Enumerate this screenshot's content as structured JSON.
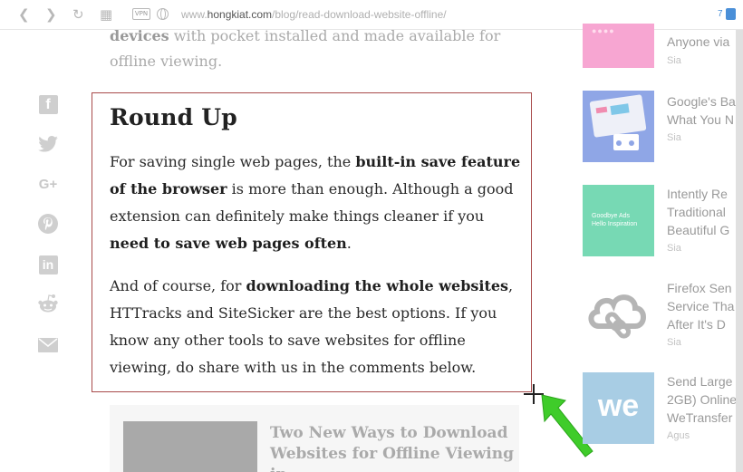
{
  "browser": {
    "url_prefix": "www.",
    "url_domain": "hongkiat.com",
    "url_path": "/blog/read-download-website-offline/",
    "vpn_label": "VPN",
    "ext_badge": "7",
    "icons": [
      "back-icon",
      "forward-icon",
      "reload-icon",
      "grid-icon",
      "globe-icon"
    ]
  },
  "article": {
    "top_bold": "devices",
    "top_rest": " with pocket installed and made available for offline viewing.",
    "heading": "Round Up",
    "p1": [
      {
        "t": "For saving single web pages, the ",
        "b": false
      },
      {
        "t": "built-in save feature of the browser",
        "b": true
      },
      {
        "t": " is more than enough. Although a good extension can definitely make things cleaner if you ",
        "b": false
      },
      {
        "t": "need to save web pages often",
        "b": true
      },
      {
        "t": ".",
        "b": false
      }
    ],
    "p2": [
      {
        "t": "And of course, for ",
        "b": false
      },
      {
        "t": "downloading the whole websites",
        "b": true
      },
      {
        "t": ", HTTracks and SiteSicker are the best options. If you know any other tools to save websites for offline viewing, do share with us in the comments below.",
        "b": false
      }
    ]
  },
  "social": {
    "facebook": "f",
    "google_plus": "G+",
    "linkedin": "in"
  },
  "related": {
    "title": "Two New Ways to Download Websites for Offline Viewing in"
  },
  "sidebar": {
    "items": [
      {
        "title": "Anyone via",
        "author": "Sia"
      },
      {
        "title": "Google's Ba What You N",
        "author": "Sia"
      },
      {
        "title": "Intently Re Traditional Beautiful G",
        "author": "Sia"
      },
      {
        "title": "Firefox Sen Service Tha After It's D",
        "author": "Sia"
      },
      {
        "title": "Send Large 2GB) Online WeTransfer",
        "author": "Agus"
      }
    ]
  },
  "colors": {
    "box_border": "#a84a4a",
    "arrow_green": "#3fcc2a"
  }
}
